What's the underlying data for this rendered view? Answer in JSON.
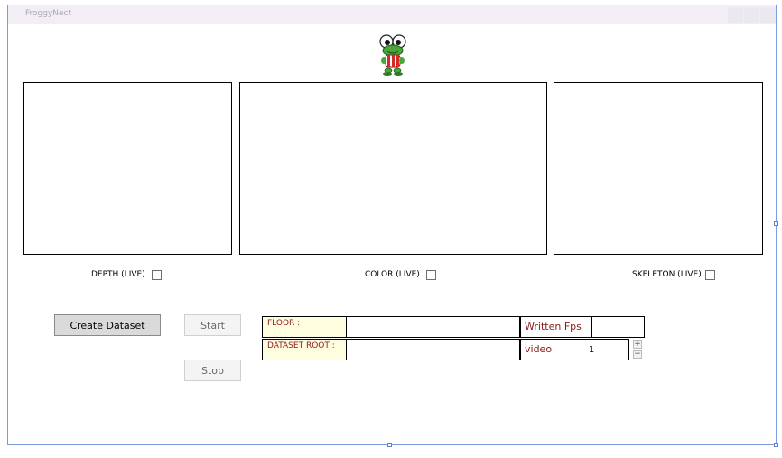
{
  "window": {
    "title": "FroggyNect"
  },
  "panels": {
    "depth_label": "DEPTH (LIVE)",
    "color_label": "COLOR (LIVE)",
    "skeleton_label": "SKELETON (LIVE)"
  },
  "buttons": {
    "create_dataset": "Create Dataset",
    "start": "Start",
    "stop": "Stop"
  },
  "form": {
    "floor_label": "FLOOR :",
    "floor_value": "",
    "dataset_root_label": "DATASET ROOT :",
    "dataset_root_value": "",
    "written_fps_label": "Written Fps",
    "written_fps_value": "",
    "video_label": "video",
    "video_value": "1",
    "spinner_up": "+",
    "spinner_down": "−"
  },
  "icons": {
    "logo": "frog-logo-icon"
  },
  "colors": {
    "frame_border": "#7a9be0",
    "field_label_bg": "#fffde0",
    "field_label_text": "#8b1a1a"
  }
}
